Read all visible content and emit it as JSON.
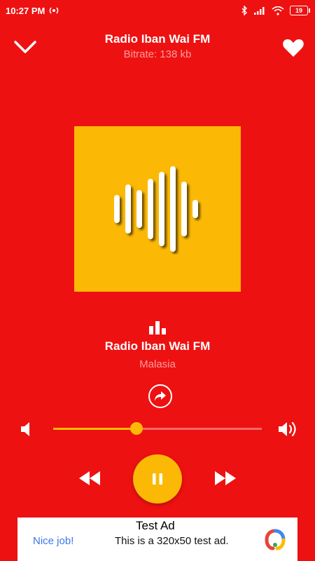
{
  "status_bar": {
    "time": "10:27 PM",
    "battery": "19",
    "icons": [
      "radio-signal-icon",
      "bluetooth-icon",
      "cell-signal-icon",
      "wifi-icon",
      "battery-icon"
    ]
  },
  "header": {
    "title": "Radio Iban Wai FM",
    "bitrate": "Bitrate: 138 kb"
  },
  "station": {
    "name": "Radio Iban Wai FM",
    "country": "Malasia"
  },
  "volume": {
    "level": 0.4
  },
  "player": {
    "state": "playing"
  },
  "ad": {
    "label": "Test Ad",
    "nice": "Nice job!",
    "text": "This is a 320x50 test ad."
  },
  "colors": {
    "background": "#EE1111",
    "accent": "#FBB905",
    "subtext": "#FF9C9C",
    "ad_link": "#3B78E7"
  }
}
